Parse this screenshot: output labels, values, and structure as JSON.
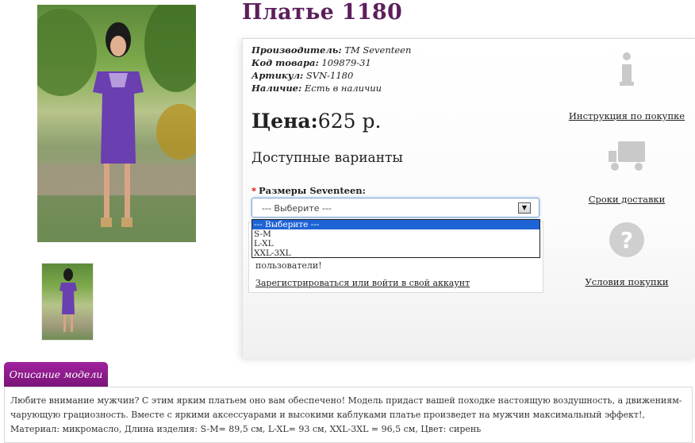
{
  "product": {
    "title": "Платье 1180",
    "manufacturer_label": "Производитель:",
    "manufacturer_value": "TM Seventeen",
    "code_label": "Код товара:",
    "code_value": "109879-31",
    "sku_label": "Артикул:",
    "sku_value": "SVN-1180",
    "availability_label": "Наличие:",
    "availability_value": "Есть в наличии",
    "price_label": "Цена:",
    "price_value": "625 р.",
    "variants_heading": "Доступные варианты",
    "size_label": "Размеры Seventeen:",
    "size_required": "*"
  },
  "size_select": {
    "selected": "--- Выберите ---",
    "options": [
      "--- Выберите ---",
      "S-M",
      "L-XL",
      "XXL-3XL"
    ]
  },
  "login_notice": {
    "message": "пользователи!",
    "link": "Зарегистрироваться или войти в свой аккаунт"
  },
  "sidebar": {
    "instructions": "Инструкция по покупке",
    "delivery": "Сроки доставки",
    "conditions": "Условия покупки"
  },
  "description": {
    "tab": "Описание модели",
    "text": "Любите внимание мужчин? С этим ярким платьем оно вам обеспечено! Модель придаст вашей походке настоящую воздушность, а движениям-чарующую грациозность. Вместе с яркими аксессуарами и высокими каблуками платье произведет на мужчин максимальный эффект!, Материал: микромасло, Длина изделия: S-M= 89,5 см, L-XL= 93 см, XXL-3XL = 96,5 см, Цвет: сирень"
  },
  "colors": {
    "title": "#5c1f5c",
    "tab": "#8b1b89",
    "dress": "#6a3fb0",
    "selection": "#1e63d6"
  }
}
